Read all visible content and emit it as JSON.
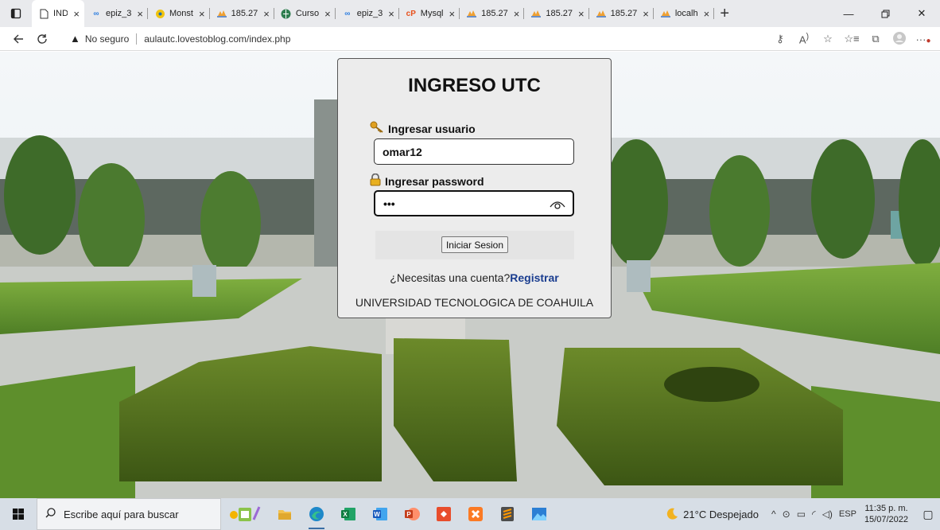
{
  "browser": {
    "tabs": [
      {
        "label": "INDEX",
        "icon": "page-icon",
        "active": true
      },
      {
        "label": "epiz_3",
        "icon": "infinity-icon"
      },
      {
        "label": "Monst",
        "icon": "circle-icon"
      },
      {
        "label": "185.27",
        "icon": "phpmyadmin-icon"
      },
      {
        "label": "Curso",
        "icon": "globe-icon"
      },
      {
        "label": "epiz_3",
        "icon": "infinity-icon"
      },
      {
        "label": "Mysql",
        "icon": "cp-icon"
      },
      {
        "label": "185.27",
        "icon": "phpmyadmin-icon"
      },
      {
        "label": "185.27",
        "icon": "phpmyadmin-icon"
      },
      {
        "label": "185.27",
        "icon": "phpmyadmin-icon"
      },
      {
        "label": "localh",
        "icon": "phpmyadmin-icon"
      }
    ],
    "close_glyph": "×",
    "security_label": "No seguro",
    "url": "aulautc.lovestoblog.com/index.php"
  },
  "login": {
    "title": "INGRESO UTC",
    "user_label": "Ingresar usuario",
    "user_value": "omar12",
    "pass_label": "Ingresar password",
    "pass_value": "•••",
    "submit_label": "Iniciar Sesion",
    "register_prompt": "¿Necesitas una cuenta?",
    "register_link": "Registrar",
    "footer": "UNIVERSIDAD TECNOLOGICA DE COAHUILA"
  },
  "taskbar": {
    "search_placeholder": "Escribe aquí para buscar",
    "weather": "21°C Despejado",
    "lang": "ESP",
    "time": "11:35 p. m.",
    "date": "15/07/2022"
  },
  "colors": {
    "register_link": "#1a3d8f",
    "card_bg": "#ececec",
    "taskbar_bg": "#d7dee6"
  }
}
